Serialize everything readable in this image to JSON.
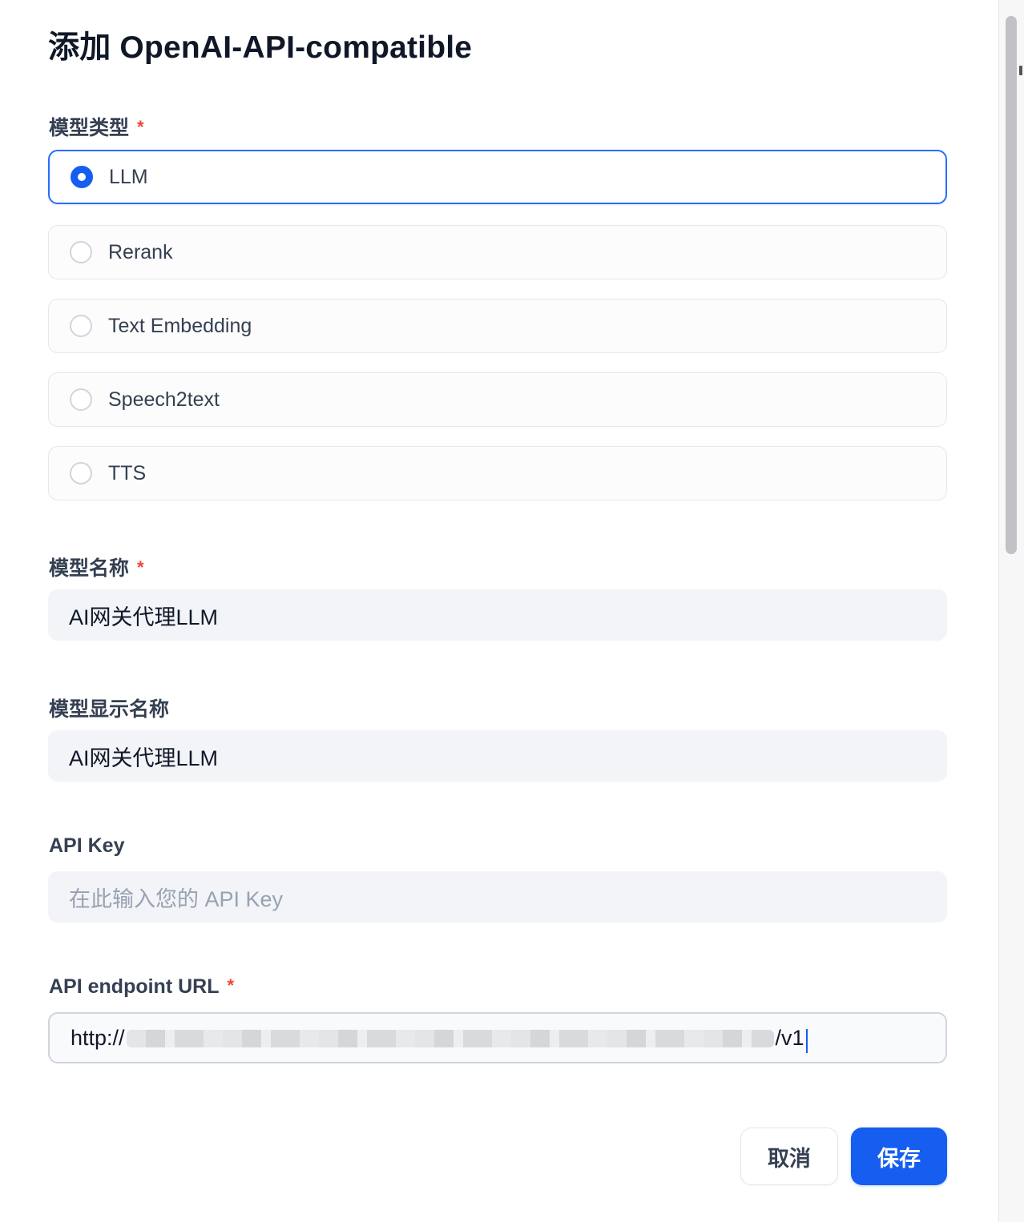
{
  "dialog": {
    "title": "添加 OpenAI-API-compatible",
    "required_mark": "*"
  },
  "model_type": {
    "label": "模型类型",
    "options": [
      {
        "label": "LLM",
        "selected": true
      },
      {
        "label": "Rerank",
        "selected": false
      },
      {
        "label": "Text Embedding",
        "selected": false
      },
      {
        "label": "Speech2text",
        "selected": false
      },
      {
        "label": "TTS",
        "selected": false
      }
    ]
  },
  "model_name": {
    "label": "模型名称",
    "value": "AI网关代理LLM"
  },
  "display_name": {
    "label": "模型显示名称",
    "value": "AI网关代理LLM"
  },
  "api_key": {
    "label": "API Key",
    "placeholder": "在此输入您的 API Key"
  },
  "endpoint": {
    "label": "API endpoint URL",
    "value_prefix": "http://",
    "value_suffix": "/v1"
  },
  "actions": {
    "cancel_label": "取消",
    "save_label": "保存"
  },
  "colors": {
    "accent": "#155eef",
    "required": "#f04438",
    "input_bg": "#f2f4f7"
  }
}
